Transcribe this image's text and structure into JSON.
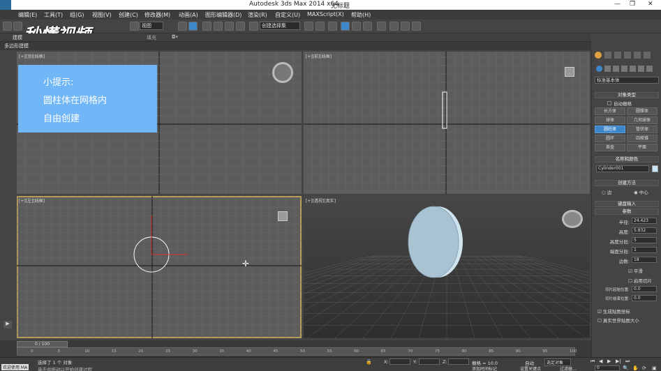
{
  "window": {
    "title": "Autodesk 3ds Max  2014 x64",
    "file": "无标题"
  },
  "menu": [
    "编辑(E)",
    "工具(T)",
    "组(G)",
    "视图(V)",
    "创建(C)",
    "修改器(M)",
    "动画(A)",
    "图形编辑器(D)",
    "渲染(R)",
    "自定义(U)",
    "MAXScript(X)",
    "帮助(H)"
  ],
  "toolbar": {
    "view_combo": "视图",
    "selection_combo": "创建选择集"
  },
  "ribbon": {
    "tab_label": "建模",
    "fill_label": "填充",
    "sub_label": "多边形建模"
  },
  "viewports": {
    "top": "[+][顶][线框]",
    "front": "[+][前][线框]",
    "left": "[+][左][线框]",
    "persp": "[+][透视][真实]"
  },
  "tip": {
    "title": "小提示:",
    "line1": "圆柱体在网格内",
    "line2": "自由创建"
  },
  "logo": "秒懂视频",
  "panel": {
    "category": "标准基本体",
    "object_type_header": "对象类型",
    "autogrid": "自动栅格",
    "buttons": [
      "长方体",
      "圆锥体",
      "球体",
      "几何球体",
      "圆柱体",
      "管状体",
      "圆环",
      "四棱锥",
      "茶壶",
      "平面"
    ],
    "selected_button": "圆柱体",
    "name_color_header": "名称和颜色",
    "name_value": "Cylinder001",
    "creation_method_header": "创建方法",
    "method_edge": "边",
    "method_center": "中心",
    "keyboard_header": "键盘输入",
    "params_header": "参数",
    "radius_label": "半径:",
    "radius_value": "24.423",
    "height_label": "高度:",
    "height_value": "5.832",
    "height_segs_label": "高度分段:",
    "height_segs_value": "5",
    "cap_segs_label": "端面分段:",
    "cap_segs_value": "1",
    "sides_label": "边数:",
    "sides_value": "18",
    "smooth_label": "平滑",
    "slice_on_label": "启用切片",
    "slice_from_label": "切片起始位置:",
    "slice_from_value": "0.0",
    "slice_to_label": "切片结束位置:",
    "slice_to_value": "0.0",
    "gen_map_label": "生成贴图坐标",
    "real_world_label": "真实世界贴图大小"
  },
  "timeline": {
    "frame": "0 / 100",
    "ticks": [
      "0",
      "5",
      "10",
      "15",
      "20",
      "25",
      "30",
      "35",
      "40",
      "45",
      "50",
      "55",
      "60",
      "65",
      "70",
      "75",
      "80",
      "85",
      "90",
      "95",
      "100"
    ]
  },
  "status": {
    "welcome": "欢迎使用 MA",
    "selected": "选择了 1 个 对象",
    "hint": "单击并拖动以开始创建过程",
    "x_label": "X:",
    "y_label": "Y:",
    "z_label": "Z:",
    "grid": "栅格 = 10.0",
    "auto": "自动",
    "selected_obj": "选定对象",
    "set_key": "设置关键点",
    "filter": "过滤器...",
    "add_tag": "添加时间标记",
    "frame_value": "0"
  },
  "colors": {
    "tip_bg": "#71b7f7",
    "selected_btn": "#3d86c8",
    "active_border": "#b79f5a"
  }
}
